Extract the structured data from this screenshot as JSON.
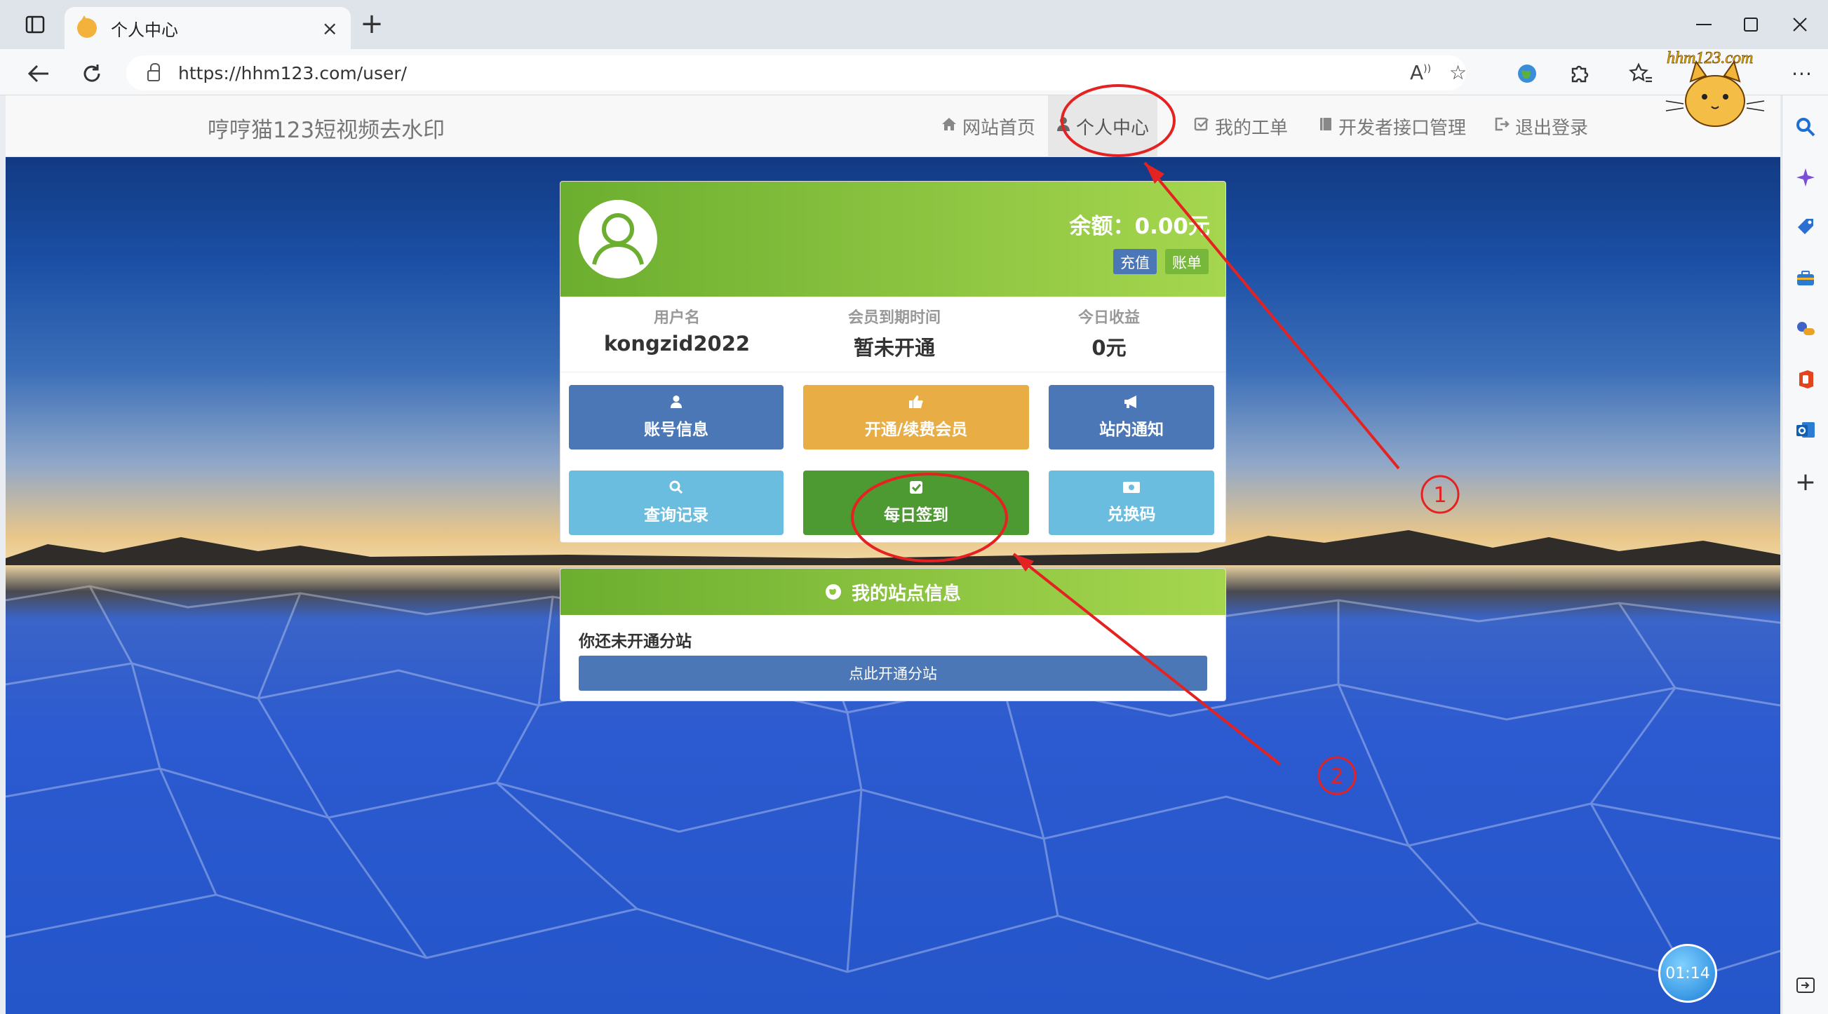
{
  "browser": {
    "tab_title": "个人中心",
    "tab_close": "×",
    "new_tab": "+",
    "url": "https://hhm123.com/user/",
    "more": "···"
  },
  "site": {
    "brand": "哼哼猫123短视频去水印",
    "nav": [
      {
        "label": "网站首页",
        "icon": "home-icon"
      },
      {
        "label": "个人中心",
        "icon": "user-icon",
        "active": true
      },
      {
        "label": "我的工单",
        "icon": "checkbox-icon"
      },
      {
        "label": "开发者接口管理",
        "icon": "book-icon"
      },
      {
        "label": "退出登录",
        "icon": "logout-icon"
      }
    ]
  },
  "user_card": {
    "balance": "余额：0.00元",
    "recharge": "充值",
    "bill": "账单",
    "stats": [
      {
        "label": "用户名",
        "value": "kongzid2022"
      },
      {
        "label": "会员到期时间",
        "value": "暂未开通"
      },
      {
        "label": "今日收益",
        "value": "0元"
      }
    ],
    "actions": [
      {
        "label": "账号信息",
        "icon": "user-icon"
      },
      {
        "label": "开通/续费会员",
        "icon": "thumbs-up-icon"
      },
      {
        "label": "站内通知",
        "icon": "bullhorn-icon"
      },
      {
        "label": "查询记录",
        "icon": "search-icon"
      },
      {
        "label": "每日签到",
        "icon": "checkbox-icon"
      },
      {
        "label": "兑换码",
        "icon": "money-icon"
      }
    ]
  },
  "site_info": {
    "title": "我的站点信息",
    "message": "你还未开通分站",
    "button": "点此开通分站"
  },
  "annotations": {
    "marker_1": "①",
    "marker_2": "②",
    "watermark": "hhm123.com"
  },
  "timer": "01:14",
  "colors": {
    "header_green": "#8cc63f",
    "button_blue": "#4b77b6",
    "button_orange": "#e8ad45",
    "button_lightblue": "#6bbde0",
    "button_green": "#4d9a32",
    "annotation_red": "#e52222"
  }
}
